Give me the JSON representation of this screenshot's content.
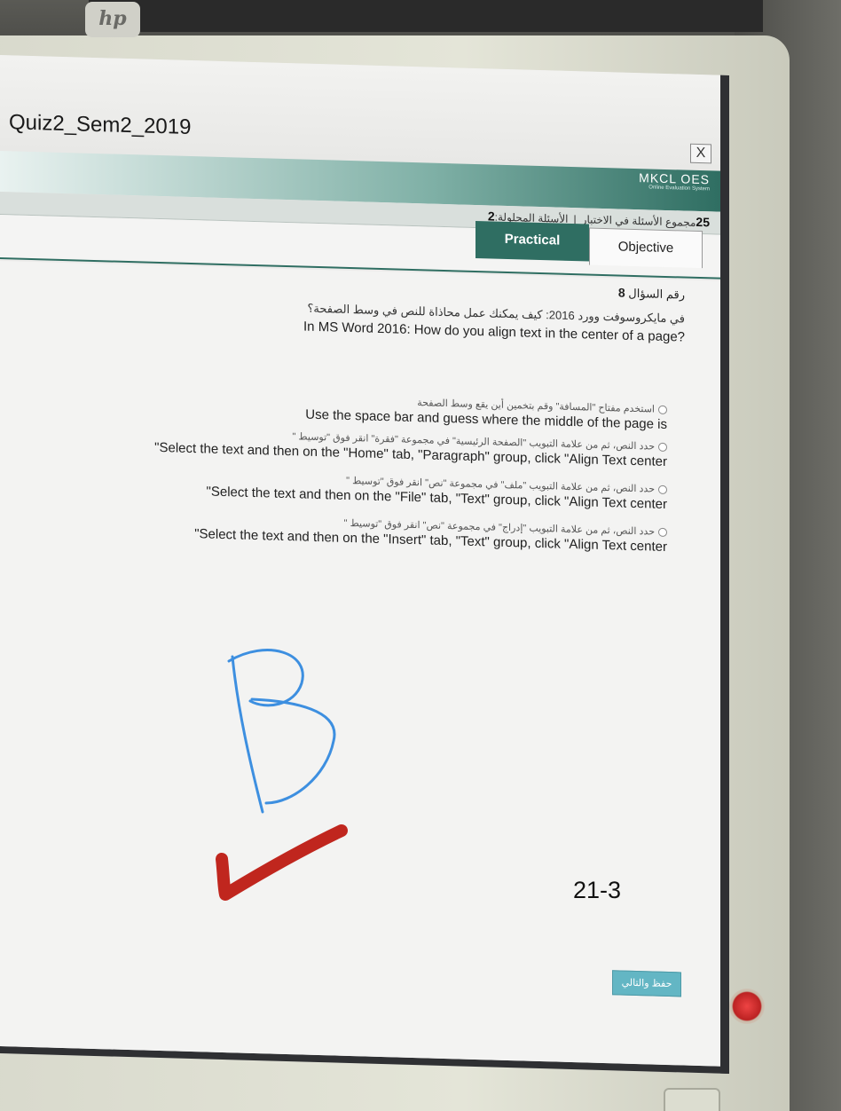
{
  "window": {
    "title": "Quiz2_Sem2_2019",
    "close_label": "X"
  },
  "app": {
    "brand_name": "MKCL OES",
    "brand_sub": "Online Evaluation System"
  },
  "stats": {
    "total_questions_label": "مجموع الأسئلة في الاختبار",
    "total_questions_value": "25",
    "separator": "|",
    "solved_label": "الأسئلة المحلولة:",
    "solved_value": "2"
  },
  "tabs": {
    "practical": "Practical",
    "objective": "Objective"
  },
  "question": {
    "number_label": "رقم السؤال",
    "number_value": "8",
    "text_ar": "في مايكروسوفت وورد 2016: كيف يمكنك عمل محاذاة للنص في وسط الصفحة؟",
    "text_en": "In MS Word 2016: How do you align text in the center of a page?",
    "options": [
      {
        "ar": "استخدم مفتاح \"المسافة\" وقم بتخمين أين يقع وسط الصفحة",
        "en": "Use the space bar and guess where the middle of the page is"
      },
      {
        "ar": "حدد النص، ثم من علامة التبويب \"الصفحة الرئيسية\" في مجموعة \"فقرة\" انقر فوق \"توسيط \"",
        "en": "\"Select the text and then on the \"Home\" tab, \"Paragraph\" group, click \"Align Text center"
      },
      {
        "ar": "حدد النص، ثم من علامة التبويب \"ملف\" في مجموعة \"نص\" انقر فوق \"توسيط \"",
        "en": "\"Select the text and then on the \"File\" tab, \"Text\" group, click \"Align Text center"
      },
      {
        "ar": "حدد النص، ثم من علامة التبويب \"إدراج\" في مجموعة \"نص\" انقر فوق \"توسيط \"",
        "en": "\"Select the text and then on the \"Insert\" tab, \"Text\" group, click \"Align Text center"
      }
    ]
  },
  "save_button": "حفظ والتالي",
  "annotations": {
    "handwritten_letter": "B",
    "page_note": "21-3",
    "ink_blue": "#3d8fe0",
    "ink_red": "#c0261e"
  },
  "hardware": {
    "logo": "hp"
  },
  "colors": {
    "accent": "#2f6e62",
    "save_button": "#63b6c4"
  }
}
